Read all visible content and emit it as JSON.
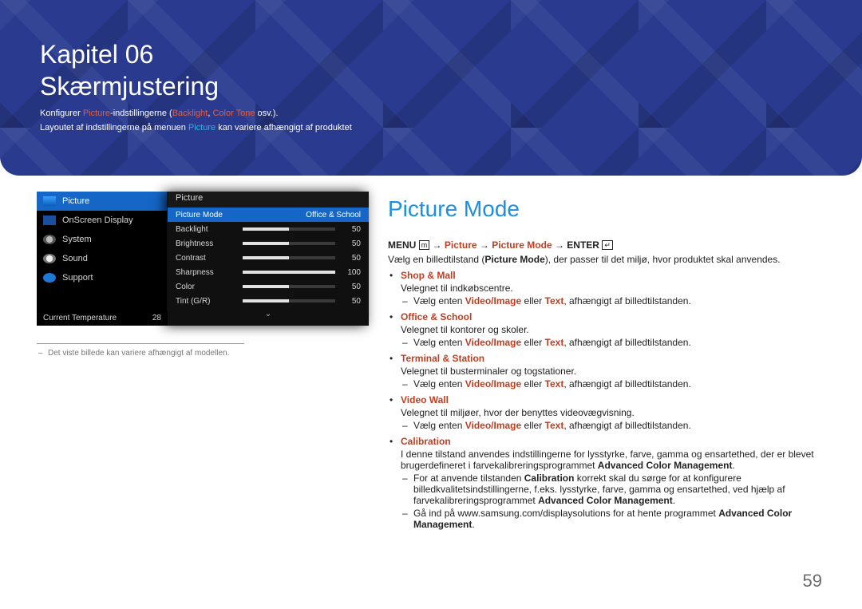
{
  "hero": {
    "chapter": "Kapitel 06",
    "title": "Skærmjustering",
    "intro1_a": "Konfigurer ",
    "intro1_b": "Picture",
    "intro1_c": "-indstillingerne (",
    "intro1_d": "Backlight",
    "intro1_e": ", ",
    "intro1_f": "Color Tone",
    "intro1_g": " osv.).",
    "intro2_a": "Layoutet af indstillingerne på menuen ",
    "intro2_b": "Picture",
    "intro2_c": " kan variere afhængigt af produktet"
  },
  "osd": {
    "sidebar": {
      "picture": "Picture",
      "onscreen": "OnScreen Display",
      "system": "System",
      "sound": "Sound",
      "support": "Support"
    },
    "footer": {
      "label": "Current Temperature",
      "value": "28"
    },
    "panel": {
      "title": "Picture",
      "rows": [
        {
          "label": "Picture Mode",
          "selected_value": "Office & School",
          "selected": true
        },
        {
          "label": "Backlight",
          "value": "50",
          "pct": 50
        },
        {
          "label": "Brightness",
          "value": "50",
          "pct": 50
        },
        {
          "label": "Contrast",
          "value": "50",
          "pct": 50
        },
        {
          "label": "Sharpness",
          "value": "100",
          "pct": 100
        },
        {
          "label": "Color",
          "value": "50",
          "pct": 50
        },
        {
          "label": "Tint (G/R)",
          "value": "50",
          "pct": 50
        }
      ],
      "more_indicator": "⌄"
    },
    "note": "Det viste billede kan variere afhængigt af modellen."
  },
  "article": {
    "heading": "Picture Mode",
    "path": {
      "menu": "MENU",
      "arrow": " → ",
      "seg1": "Picture",
      "seg2": "Picture Mode",
      "enter": "ENTER"
    },
    "intro_a": "Vælg en billedtilstand (",
    "intro_b": "Picture Mode",
    "intro_c": "), der passer til det miljø, hvor produktet skal anvendes.",
    "options": [
      {
        "name": "Shop & Mall",
        "desc": "Velegnet til indkøbscentre.",
        "dash1_a": "Vælg enten ",
        "dash1_b": "Video/Image",
        "dash1_c": " eller ",
        "dash1_d": "Text",
        "dash1_e": ", afhængigt af billedtilstanden."
      },
      {
        "name": "Office & School",
        "desc": "Velegnet til kontorer og skoler.",
        "dash1_a": "Vælg enten ",
        "dash1_b": "Video/Image",
        "dash1_c": " eller ",
        "dash1_d": "Text",
        "dash1_e": ", afhængigt af billedtilstanden."
      },
      {
        "name": "Terminal & Station",
        "desc": "Velegnet til busterminaler og togstationer.",
        "dash1_a": "Vælg enten ",
        "dash1_b": "Video/Image",
        "dash1_c": " eller ",
        "dash1_d": "Text",
        "dash1_e": ", afhængigt af billedtilstanden."
      },
      {
        "name": "Video Wall",
        "desc": "Velegnet til miljøer, hvor der benyttes videovægvisning.",
        "dash1_a": "Vælg enten ",
        "dash1_b": "Video/Image",
        "dash1_c": " eller ",
        "dash1_d": "Text",
        "dash1_e": ", afhængigt af billedtilstanden."
      }
    ],
    "calibration": {
      "name": "Calibration",
      "desc_a": "I denne tilstand anvendes indstillingerne for lysstyrke, farve, gamma og ensartethed, der er blevet brugerdefineret i farvekalibreringsprogrammet ",
      "desc_b": "Advanced Color Management",
      "desc_c": ".",
      "d1_a": "For at anvende tilstanden ",
      "d1_b": "Calibration",
      "d1_c": " korrekt skal du sørge for at konfigurere billedkvalitetsindstillingerne, f.eks. lysstyrke, farve, gamma og ensartethed, ved hjælp af farvekalibreringsprogrammet ",
      "d1_d": "Advanced Color Management",
      "d1_e": ".",
      "d2_a": "Gå ind på www.samsung.com/displaysolutions for at hente programmet ",
      "d2_b": "Advanced Color Management",
      "d2_c": "."
    }
  },
  "page_number": "59"
}
